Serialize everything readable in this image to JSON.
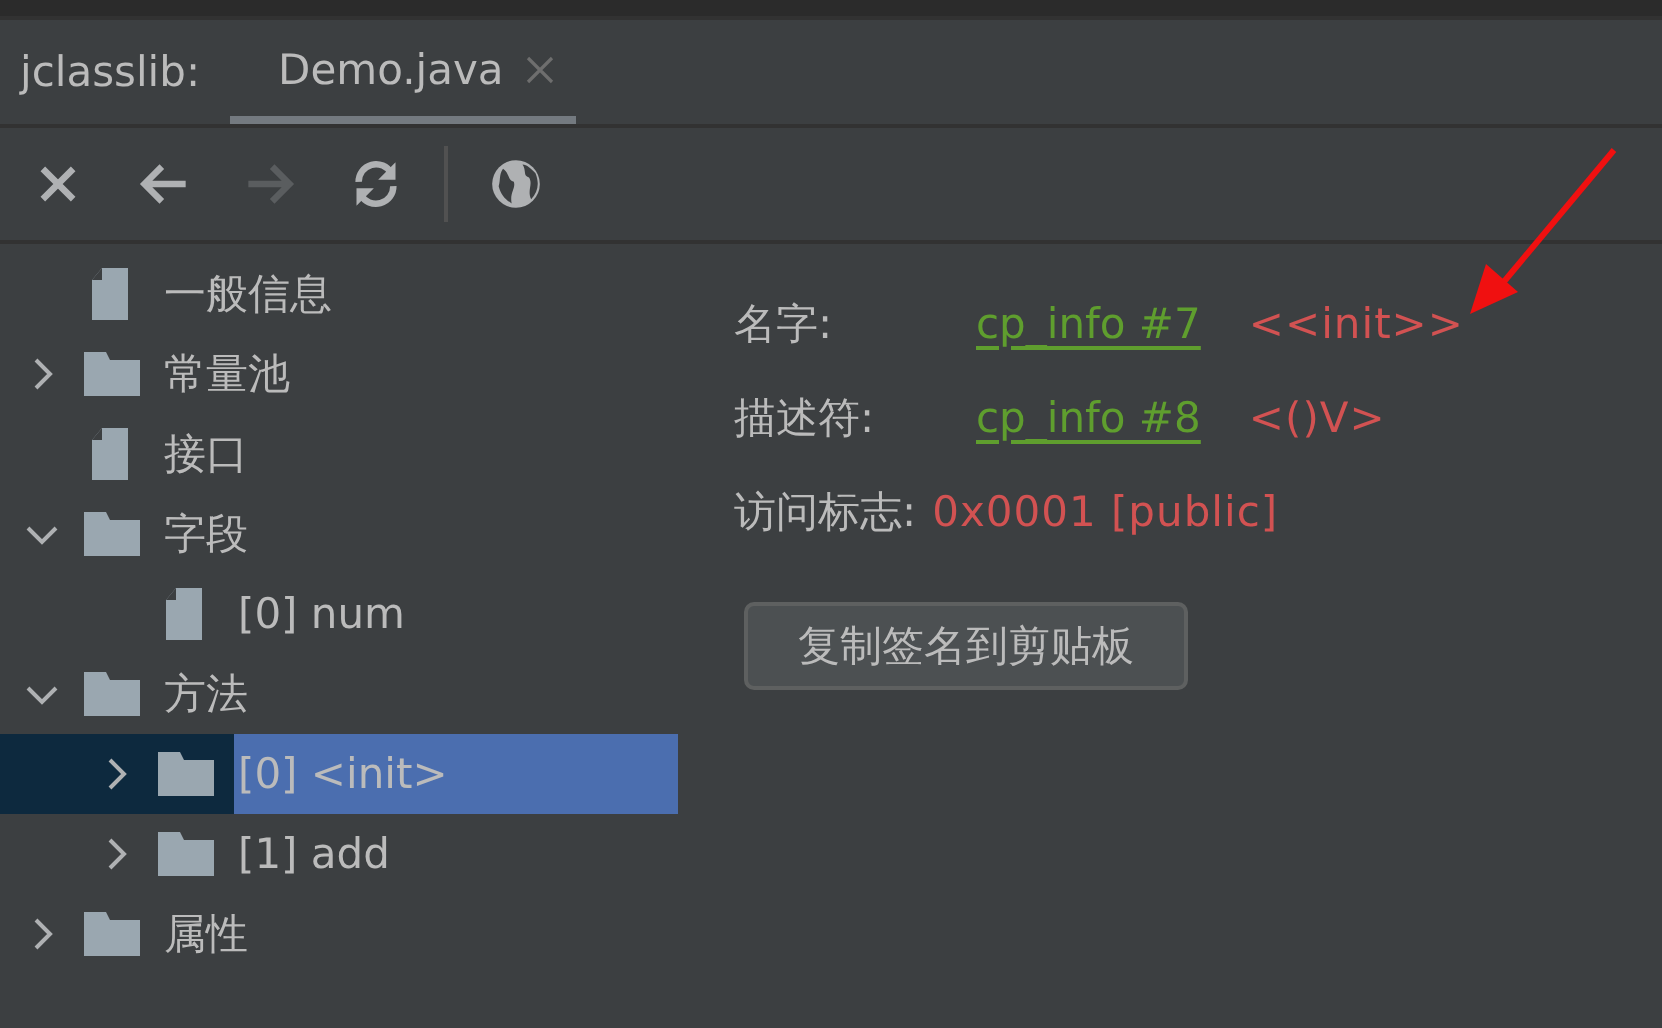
{
  "tool_window": {
    "title": "jclasslib:"
  },
  "tabs": [
    {
      "label": "Demo.java",
      "selected": true
    }
  ],
  "toolbar": [
    {
      "kind": "close",
      "disabled": false
    },
    {
      "kind": "back",
      "disabled": false
    },
    {
      "kind": "forward",
      "disabled": true
    },
    {
      "kind": "refresh",
      "disabled": false
    },
    {
      "kind": "separator"
    },
    {
      "kind": "web",
      "disabled": false
    }
  ],
  "tree": [
    {
      "label": "一般信息",
      "kind": "file",
      "selected": false
    },
    {
      "label": "常量池",
      "kind": "folder",
      "expanded": false,
      "selected": false
    },
    {
      "label": "接口",
      "kind": "file",
      "selected": false
    },
    {
      "label": "字段",
      "kind": "folder",
      "expanded": true,
      "selected": false,
      "children": [
        {
          "label": "[0] num",
          "kind": "file",
          "selected": false
        }
      ]
    },
    {
      "label": "方法",
      "kind": "folder",
      "expanded": true,
      "selected": false,
      "children": [
        {
          "label": "[0] <init>",
          "kind": "folder",
          "expanded": false,
          "selected": true
        },
        {
          "label": "[1] add",
          "kind": "folder",
          "expanded": false,
          "selected": false
        }
      ]
    },
    {
      "label": "属性",
      "kind": "folder",
      "expanded": false,
      "selected": false
    }
  ],
  "details": [
    {
      "label": "名字:",
      "link": "cp_info #7",
      "value": "<<init>>"
    },
    {
      "label": "描述符:",
      "link": "cp_info #8",
      "value": "<()V>"
    },
    {
      "label": "访问标志:",
      "value": "0x0001 [public]"
    }
  ],
  "copy_button": {
    "label": "复制签名到剪贴板"
  },
  "annotation": {
    "kind": "arrow"
  }
}
